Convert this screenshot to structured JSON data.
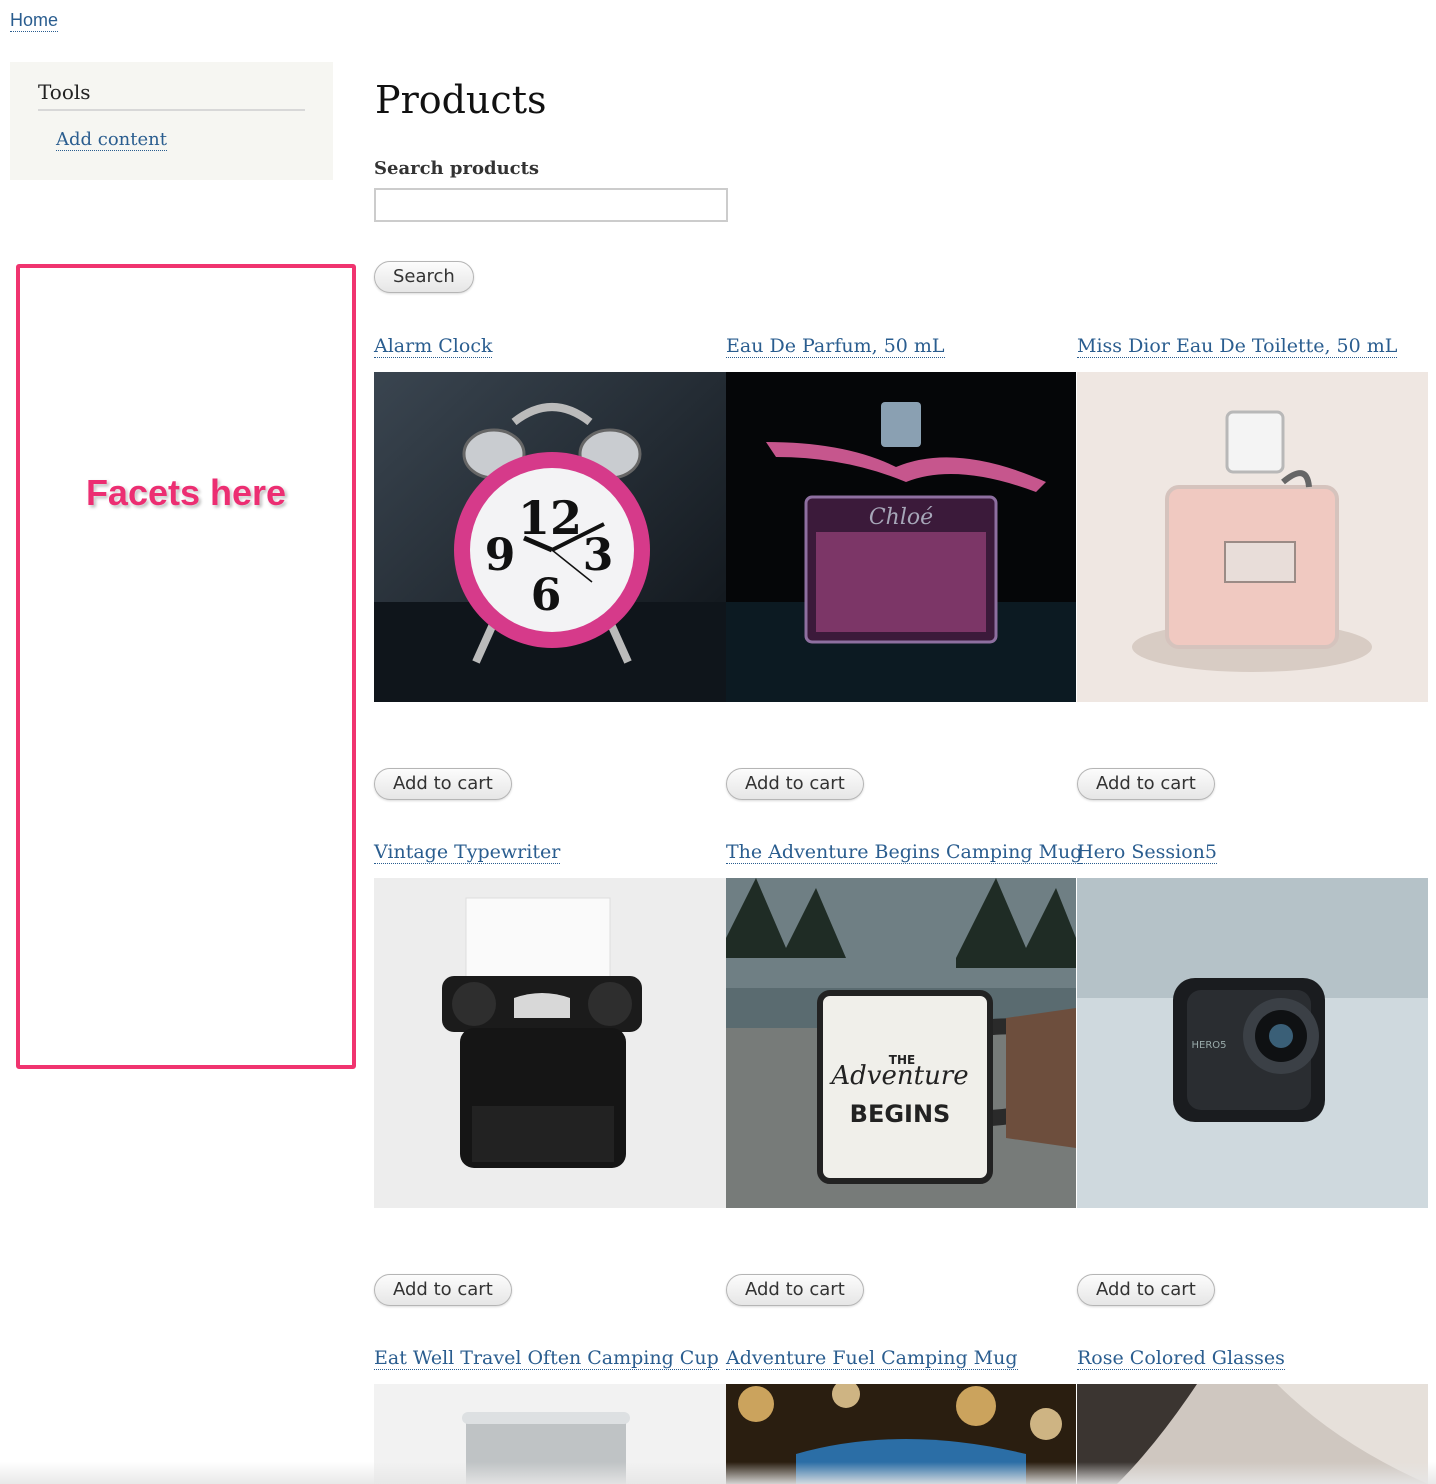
{
  "breadcrumb": {
    "home": "Home"
  },
  "sidebar": {
    "tools_title": "Tools",
    "add_content": "Add content",
    "facets_placeholder": "Facets here"
  },
  "main": {
    "title": "Products",
    "search_label": "Search products",
    "search_value": "",
    "search_button": "Search"
  },
  "products": [
    {
      "title": "Alarm Clock",
      "button": "Add to cart"
    },
    {
      "title": "Eau De Parfum, 50 mL",
      "button": "Add to cart"
    },
    {
      "title": "Miss Dior Eau De Toilette, 50 mL",
      "button": "Add to cart"
    },
    {
      "title": "Vintage Typewriter",
      "button": "Add to cart"
    },
    {
      "title": "The Adventure Begins Camping Mug",
      "button": "Add to cart"
    },
    {
      "title": "Hero Session5",
      "button": "Add to cart"
    },
    {
      "title": "Eat Well Travel Often Camping Cup"
    },
    {
      "title": "Adventure Fuel Camping Mug"
    },
    {
      "title": "Rose Colored Glasses"
    }
  ],
  "image_text": {
    "clock_12": "12",
    "clock_9": "9",
    "clock_3": "3",
    "clock_6": "6",
    "perfume_brand": "Chloé",
    "mug_the": "THE",
    "mug_adventure": "Adventure",
    "mug_begins": "BEGINS",
    "camera_brand": "HERO5"
  },
  "colors": {
    "link": "#2a5d8f",
    "facets_accent": "#ec2e72",
    "sidebar_bg": "#f6f6f2"
  }
}
